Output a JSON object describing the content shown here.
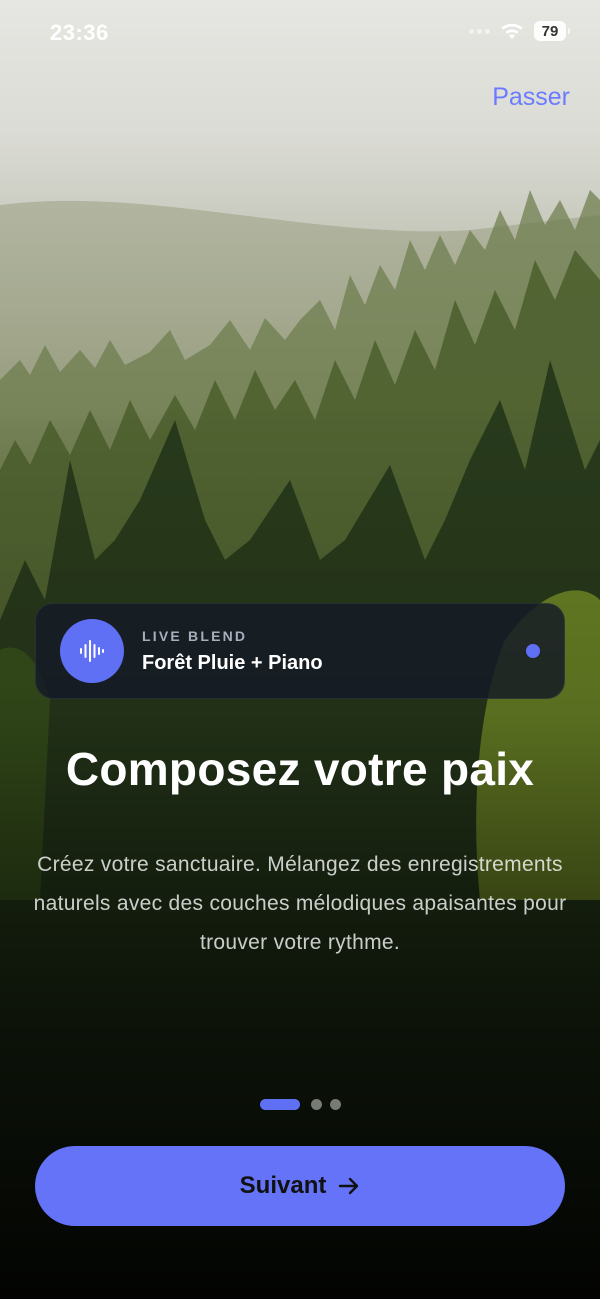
{
  "status_bar": {
    "time": "23:36",
    "battery": "79",
    "icons": [
      "signal-dots-icon",
      "wifi-icon",
      "battery-icon"
    ]
  },
  "header": {
    "skip_label": "Passer"
  },
  "blend_card": {
    "kicker": "LIVE BLEND",
    "title": "Forêt Pluie + Piano",
    "icon": "waveform-icon",
    "accent": "#6070f5"
  },
  "content": {
    "title": "Composez votre paix",
    "description": "Créez votre sanctuaire. Mélangez des enregistrements naturels avec des couches mélodiques apaisantes pour trouver votre rythme."
  },
  "pager": {
    "count": 3,
    "active_index": 0
  },
  "footer": {
    "next_label": "Suivant",
    "next_icon": "arrow-right-icon",
    "button_color": "#6473f7"
  }
}
